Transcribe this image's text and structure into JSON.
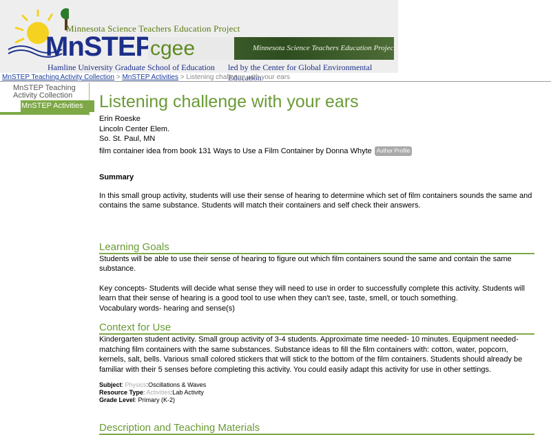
{
  "header": {
    "mnstep_top": "Minnesota Science Teachers Education Project",
    "mnstep_logo": "MnSTEP",
    "mnstep_sub": "Hamline University Graduate School of Education",
    "cgee_logo": "cgee",
    "cgee_banner_text": "Minnesota Science Teachers Education Project",
    "cgee_ledby": "led by the Center for Global Environmental Education"
  },
  "breadcrumb": {
    "link1": "MnSTEP Teaching Activity Collection",
    "sep1": " > ",
    "link2": "MnSTEP Activities",
    "sep2": " > ",
    "current": "Listening challenge with your ears"
  },
  "sidebar": {
    "collection": "MnSTEP Teaching Activity Collection",
    "activities": "MnSTEP Activities"
  },
  "page": {
    "title": "Listening challenge with your ears",
    "author": "Erin Roeske",
    "school": "Lincoln Center Elem.",
    "location": "So. St. Paul, MN",
    "source": "film container idea from book 131 Ways to Use a Film Container by Donna Whyte",
    "profile_button": "Author Profile",
    "summary_heading": "Summary",
    "summary_text": "In this small group activity, students will use their sense of hearing to determine which set of film containers sounds the same and contains the same substance. Students will match their containers and self check their answers.",
    "goals_heading": "Learning Goals",
    "goals_text1": "Students will be able to use their sense of hearing to figure out which film containers sound the same and contain the same substance.",
    "goals_text2": "Key concepts- Students will decide what sense they will need to use in order to successfully complete this activity. Students will learn that their sense of hearing is a good tool to use when they can't see, taste, smell, or touch something.",
    "goals_text3": "Vocabulary words- hearing and sense(s)",
    "context_heading": "Context for Use",
    "context_text": "Kindergarten student activity. Small group activity of 3-4 students. Approximate time needed- 10 minutes. Equipment needed- matching film containers with the same substances. Substance ideas to fill the film containers with: cotton, water, popcorn, kernels, salt, bells. Various small colored stickers that will stick to the bottom of the film containers. Students should already be familiar with their 5 senses before completing this activity. You could easily adapt this activity for use in other settings.",
    "subject_label": "Subject",
    "subject_category": "Physics",
    "subject_value": "Oscillations & Waves",
    "resource_label": "Resource Type",
    "resource_category": "Activities",
    "resource_value": "Lab Activity",
    "grade_label": "Grade Level",
    "grade_value": "Primary (K-2)",
    "next_heading": "Description and Teaching Materials"
  }
}
